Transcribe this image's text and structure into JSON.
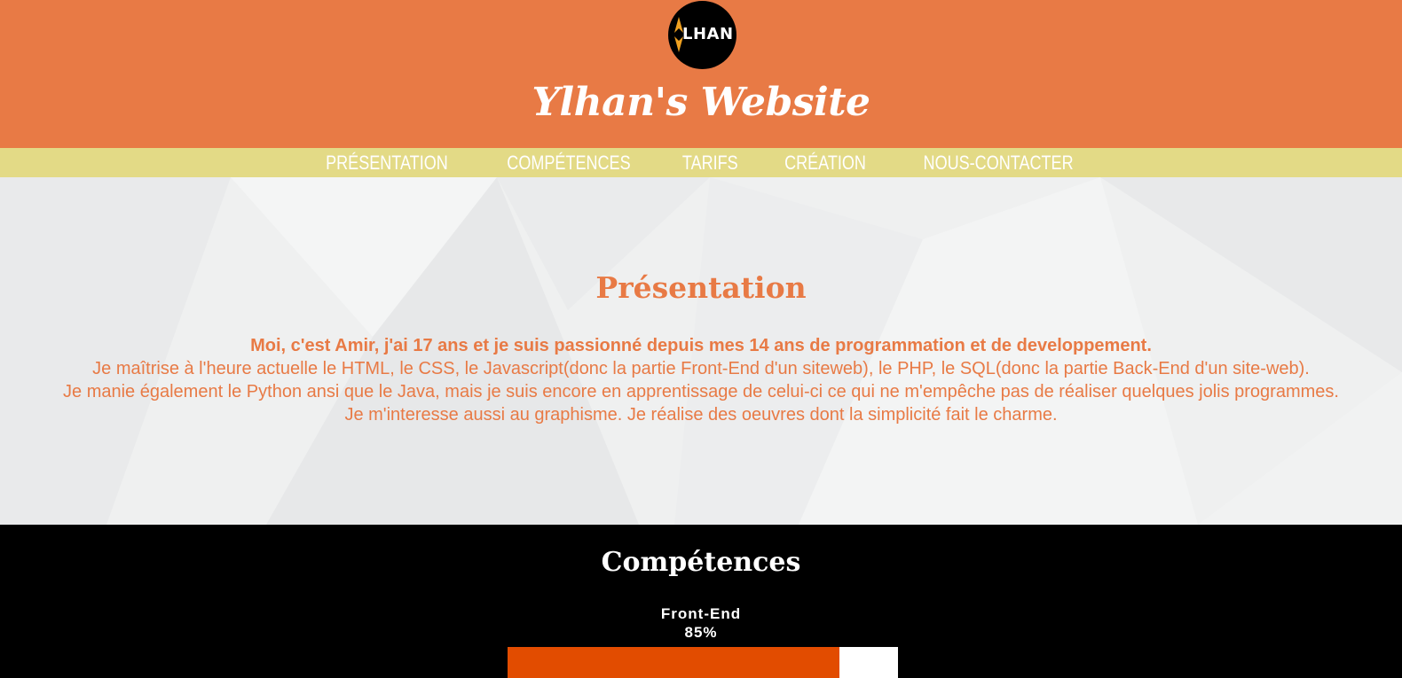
{
  "header": {
    "logo_text": "LHAN",
    "site_title": "Ylhan's Website",
    "colors": {
      "background": "#e87a45",
      "logo_bg": "#000000",
      "logo_accent": "#f0a020"
    }
  },
  "nav": {
    "items": [
      {
        "label": "Présentation"
      },
      {
        "label": "Compétences"
      },
      {
        "label": "Tarifs"
      },
      {
        "label": "Création"
      },
      {
        "label": "Nous-contacter"
      }
    ],
    "colors": {
      "background": "#e3da86",
      "text": "#ffffff"
    }
  },
  "presentation": {
    "title": "Présentation",
    "lines": [
      "Moi, c'est Amir, j'ai 17 ans et je suis passionné depuis mes 14 ans de programmation et de developpement.",
      "Je maîtrise à l'heure actuelle le HTML, le CSS, le Javascript(donc la partie Front-End d'un siteweb), le PHP, le SQL(donc la partie Back-End d'un site-web).",
      "Je manie également le Python ansi que le Java, mais je suis encore en apprentissage de celui-ci ce qui ne m'empêche pas de réaliser quelques jolis programmes.",
      "Je m'interesse aussi au graphisme. Je réalise des oeuvres dont la simplicité fait le charme."
    ],
    "colors": {
      "text": "#e87a45",
      "background": "#eff0f0"
    }
  },
  "skills": {
    "title": "Compétences",
    "items": [
      {
        "name": "Front-End",
        "percent_label": "85%",
        "percent": 85
      }
    ],
    "colors": {
      "background": "#000000",
      "bar_fill": "#e24c00",
      "bar_track": "#ffffff"
    }
  }
}
